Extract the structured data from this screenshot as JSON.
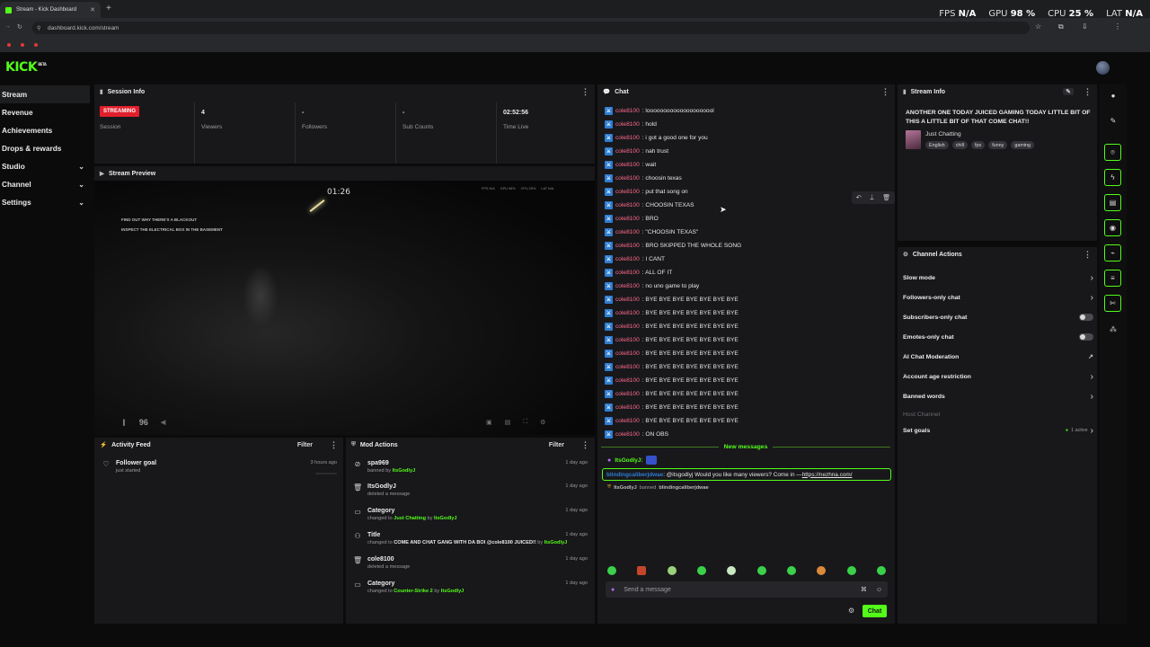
{
  "browser": {
    "tab_title": "Stream - Kick Dashboard",
    "url": "dashboard.kick.com/stream",
    "new_tab": "+"
  },
  "overlay": {
    "fps_label": "FPS",
    "fps_value": "N/A",
    "gpu_label": "GPU",
    "gpu_value": "98 %",
    "cpu_label": "CPU",
    "cpu_value": "25 %",
    "lat_label": "LAT",
    "lat_value": "N/A"
  },
  "app": {
    "logo": "KICK",
    "logo_sup": "BETA"
  },
  "sidebar": {
    "items": [
      {
        "label": "Stream",
        "active": true
      },
      {
        "label": "Revenue"
      },
      {
        "label": "Achievements"
      },
      {
        "label": "Drops & rewards"
      },
      {
        "label": "Studio",
        "chevron": "⌄"
      },
      {
        "label": "Channel",
        "chevron": "⌄"
      },
      {
        "label": "Settings",
        "chevron": "⌄"
      }
    ]
  },
  "session": {
    "title": "Session Info",
    "status_badge": "STREAMING",
    "status_label": "Session",
    "viewers_value": "4",
    "viewers_label": "Viewers",
    "followers_value": "-",
    "followers_label": "Followers",
    "subs_value": "-",
    "subs_label": "Sub Counts",
    "time_value": "02:52:56",
    "time_label": "Time Live"
  },
  "preview": {
    "title": "Stream Preview",
    "timer": "01:26",
    "objective_1": "FIND OUT WHY THERE'S A BLACKOUT",
    "objective_2": "INSPECT THE ELECTRICAL BOX IN THE BASEMENT",
    "hud": [
      "FPS N/A",
      "GPU 98%",
      "CPU 25%",
      "LAT N/A"
    ],
    "volume": "96"
  },
  "activity": {
    "title": "Activity Feed",
    "filter": "Filter",
    "items": [
      {
        "title": "Follower goal",
        "sub": "just started",
        "time": "3 hours ago"
      }
    ]
  },
  "mod": {
    "title": "Mod Actions",
    "filter": "Filter",
    "items": [
      {
        "title": "spa969",
        "sub_pre": "banned by ",
        "sub_hl": "ItsGodlyJ",
        "sub_mid": "",
        "sub_hl2": "",
        "time": "1 day ago"
      },
      {
        "title": "ItsGodlyJ",
        "sub_pre": "deleted a message",
        "sub_hl": "",
        "sub_mid": "",
        "sub_hl2": "",
        "time": "1 day ago"
      },
      {
        "title": "Category",
        "sub_pre": "changed to ",
        "sub_hl": "Just Chatting",
        "sub_mid": " by ",
        "sub_hl2": "ItsGodlyJ",
        "time": "1 day ago"
      },
      {
        "title": "Title",
        "sub_pre": "changed to ",
        "sub_hl": "COME AND CHAT GANG WITH DA BOI @cole8100 JUICED!!",
        "sub_mid": " by ",
        "sub_hl2": "ItsGodlyJ",
        "time": "1 day ago"
      },
      {
        "title": "cole8100",
        "sub_pre": "deleted a message",
        "sub_hl": "",
        "sub_mid": "",
        "sub_hl2": "",
        "time": "1 day ago"
      },
      {
        "title": "Category",
        "sub_pre": "changed to ",
        "sub_hl": "Counter-Strike 2",
        "sub_mid": " by ",
        "sub_hl2": "ItsGodlyJ",
        "time": "1 day ago"
      }
    ]
  },
  "chat": {
    "title": "Chat",
    "messages": [
      {
        "user": "cole8100",
        "text": ": looooooooooooooooooool"
      },
      {
        "user": "cole8100",
        "text": ": hold"
      },
      {
        "user": "cole8100",
        "text": ": i got a good one for you"
      },
      {
        "user": "cole8100",
        "text": ": nah trust"
      },
      {
        "user": "cole8100",
        "text": ": wait"
      },
      {
        "user": "cole8100",
        "text": ": choosin texas"
      },
      {
        "user": "cole8100",
        "text": ": put that song on"
      },
      {
        "user": "cole8100",
        "text": ": CHOOSIN TEXAS"
      },
      {
        "user": "cole8100",
        "text": ": BRO"
      },
      {
        "user": "cole8100",
        "text": ": \"CHOOSIN TEXAS\""
      },
      {
        "user": "cole8100",
        "text": ": BRO SKIPPED THE WHOLE SONG"
      },
      {
        "user": "cole8100",
        "text": ": I CANT"
      },
      {
        "user": "cole8100",
        "text": ": ALL OF IT"
      },
      {
        "user": "cole8100",
        "text": ": no uno game to play"
      },
      {
        "user": "cole8100",
        "text": ": BYE BYE BYE BYE BYE BYE BYE"
      },
      {
        "user": "cole8100",
        "text": ": BYE BYE BYE BYE BYE BYE BYE"
      },
      {
        "user": "cole8100",
        "text": ": BYE BYE BYE BYE BYE BYE BYE"
      },
      {
        "user": "cole8100",
        "text": ": BYE BYE BYE BYE BYE BYE BYE"
      },
      {
        "user": "cole8100",
        "text": ": BYE BYE BYE BYE BYE BYE BYE"
      },
      {
        "user": "cole8100",
        "text": ": BYE BYE BYE BYE BYE BYE BYE"
      },
      {
        "user": "cole8100",
        "text": ": BYE BYE BYE BYE BYE BYE BYE"
      },
      {
        "user": "cole8100",
        "text": ": BYE BYE BYE BYE BYE BYE BYE"
      },
      {
        "user": "cole8100",
        "text": ": BYE BYE BYE BYE BYE BYE BYE"
      },
      {
        "user": "cole8100",
        "text": ": BYE BYE BYE BYE BYE BYE BYE"
      },
      {
        "user": "cole8100",
        "text": ": ON OBS"
      }
    ],
    "new_messages": "New messages",
    "mod_user": "ItsGodlyJ:",
    "spam_user": "blindingcaliberjdwae",
    "spam_text": ": @itsgodlyj Would you like many viewers? Come in — ",
    "spam_link": "https://nezhna.com/",
    "ban_user": "ItsGodlyJ",
    "ban_text": " banned ",
    "ban_target": "blindingcaliberjdwae",
    "placeholder": "Send a message",
    "send_label": "Chat"
  },
  "stream_info": {
    "title": "Stream Info",
    "stream_title": "ANOTHER ONE TODAY JUICED GAMING TODAY LITTLE BIT OF THIS A LITTLE BIT OF THAT COME CHAT!!",
    "category": "Just Chatting",
    "tags": [
      "English",
      "chill",
      "fps",
      "funny",
      "gaming"
    ]
  },
  "channel_actions": {
    "title": "Channel Actions",
    "slow_mode": "Slow mode",
    "followers_only": "Followers-only chat",
    "subs_only": "Subscribers-only chat",
    "emotes_only": "Emotes-only chat",
    "ai_mod": "AI Chat Moderation",
    "age_restriction": "Account age restriction",
    "banned_words": "Banned words",
    "host_channel": "Host Channel",
    "set_goals": "Set goals",
    "goals_status": "1 active"
  },
  "colors": {
    "accent": "#53fc18",
    "live": "#e21f2c",
    "username": "#ff6b8a",
    "panel": "#18181b"
  }
}
